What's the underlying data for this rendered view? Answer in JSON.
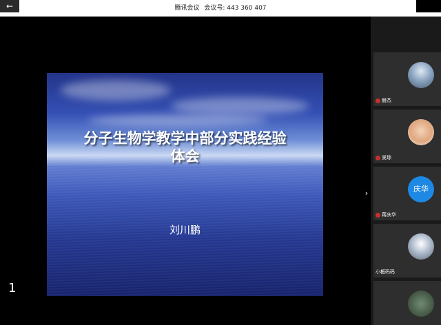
{
  "titlebar": {
    "back_icon": "←",
    "app_label": "腾讯会议",
    "meeting_label": "会议号:",
    "meeting_id": "443 360 407"
  },
  "slide": {
    "title_line1": "分子生物学教学中部分实践经验",
    "title_line2": "体会",
    "author": "刘川鹏"
  },
  "page_number": "1",
  "panel_toggle": "›",
  "participants": [
    {
      "name": "赫杰",
      "avatar": "photo-avatar"
    },
    {
      "name": "吴琮",
      "avatar": "cartoon-avatar"
    },
    {
      "name": "蒋庆华",
      "avatar_text": "庆华",
      "color": "#1e88e5"
    },
    {
      "name": "小栀码码",
      "avatar": "photo-avatar"
    },
    {
      "name": "",
      "avatar": "photo-avatar"
    }
  ]
}
